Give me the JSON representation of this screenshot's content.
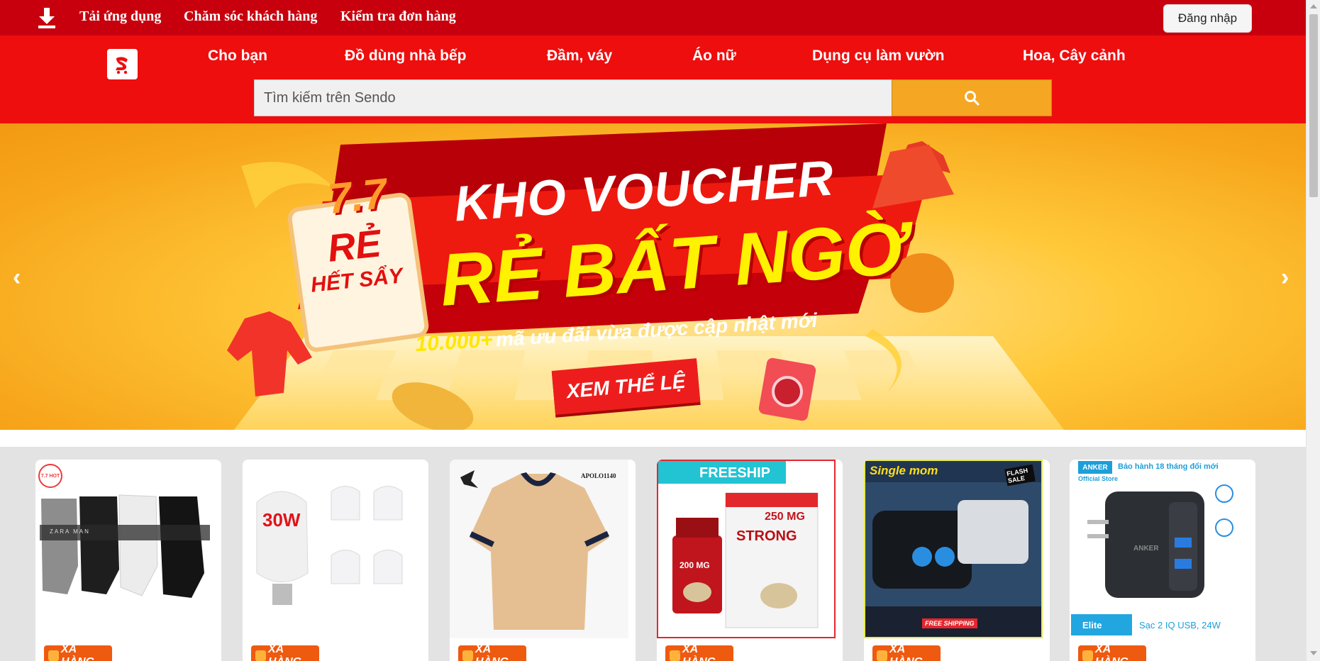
{
  "topbar": {
    "download_label": "Tải ứng dụng",
    "support_label": "Chăm sóc khách hàng",
    "order_check_label": "Kiểm tra đơn hàng",
    "login_label": "Đăng nhập"
  },
  "header": {
    "categories": [
      "Cho bạn",
      "Đồ dùng nhà bếp",
      "Đầm, váy",
      "Áo nữ",
      "Dụng cụ làm vườn",
      "Hoa, Cây cảnh"
    ],
    "search_placeholder": "Tìm kiếm trên Sendo"
  },
  "banner": {
    "badge_top": "7.7",
    "badge_mid": "RẺ",
    "badge_bottom": "HẾT SẨY",
    "headline_1": "KHO VOUCHER",
    "headline_2": "RẺ BẤT NGỜ",
    "sub_count": "10.000+",
    "sub_text": "mã ưu đãi vừa được cập nhật mới",
    "cta": "XEM THỂ LỆ",
    "prev_icon": "chevron-left-icon",
    "next_icon": "chevron-right-icon"
  },
  "products": [
    {
      "tag": "XẢ HÀNG",
      "badge": "7.7 HOT",
      "brand": "ZARA MAN"
    },
    {
      "tag": "XẢ HÀNG",
      "badge": "30W"
    },
    {
      "tag": "XẢ HÀNG",
      "brand": "APOLO1140"
    },
    {
      "tag": "XẢ HÀNG",
      "badge": "FREESHIP",
      "label_1": "STRONG",
      "label_2": "200 MG",
      "label_3": "250 MG"
    },
    {
      "tag": "XẢ HÀNG",
      "badge": "Single mom",
      "flash": "FLASH SALE",
      "free": "FREE SHIPPING"
    },
    {
      "tag": "XẢ HÀNG",
      "brand": "ANKER",
      "store": "Official Store",
      "warranty": "Bảo hành 18 tháng đổi mới",
      "tier": "Elite",
      "caption": "Sạc 2 IQ USB, 24W"
    }
  ],
  "colors": {
    "topbar": "#c8000d",
    "header": "#ee0e0e",
    "search_button": "#f5a623",
    "tag": "#ee5a10",
    "banner_red": "#d90d12",
    "banner_yellow": "#ffe600"
  }
}
